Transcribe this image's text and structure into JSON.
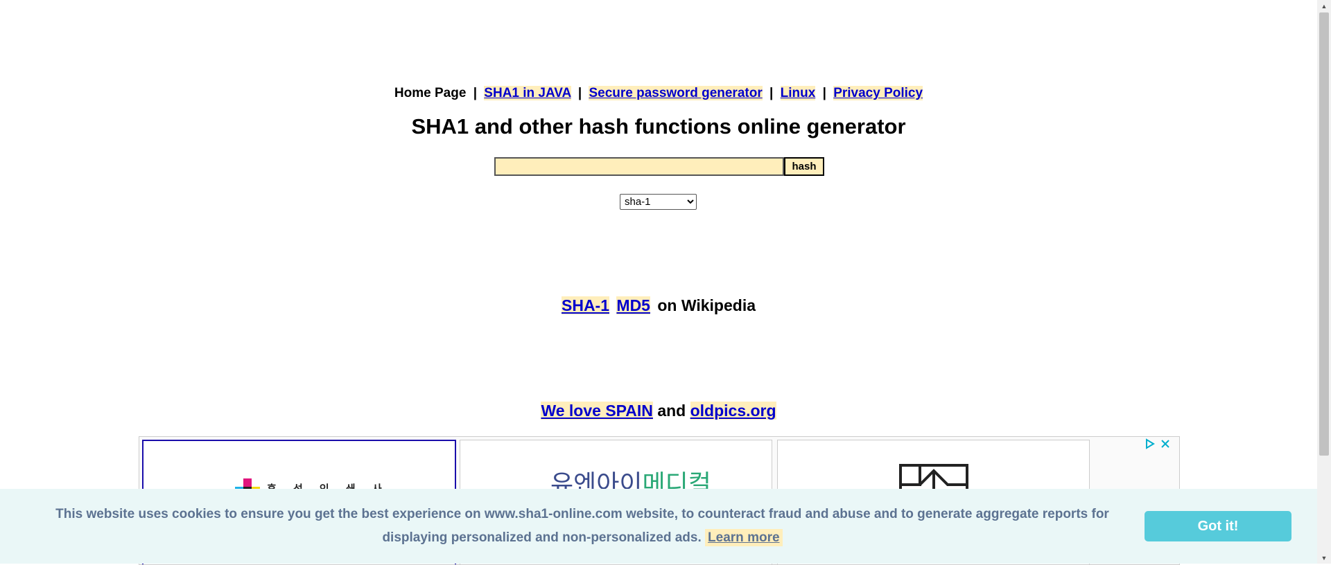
{
  "nav": {
    "home": "Home Page",
    "separator": "|",
    "links": [
      "SHA1 in JAVA",
      "Secure password generator",
      "Linux",
      "Privacy Policy"
    ]
  },
  "main": {
    "title": "SHA1 and other hash functions online generator",
    "input_value": "",
    "hash_button": "hash",
    "algorithm": "sha-1"
  },
  "wiki": {
    "links": [
      "SHA-1",
      "MD5"
    ],
    "suffix": "on Wikipedia"
  },
  "promo": {
    "link1": "We love SPAIN",
    "joiner": "and",
    "link2": "oldpics.org"
  },
  "ads": {
    "card1_text": "후 성 인 쇄 사",
    "card2_part1": "유엔아이",
    "card2_part2": "메디컬"
  },
  "cookie": {
    "message": "This website uses cookies to ensure you get the best experience on www.sha1-online.com website, to counteract fraud and abuse and to generate aggregate reports for displaying personalized and non-personalized ads.",
    "learn_more": "Learn more",
    "button": "Got it!"
  },
  "colors": {
    "link": "#0000cc",
    "highlight": "#ffeebb",
    "cookie_bg": "#eaf7f7",
    "cookie_text": "#5c7291",
    "cookie_button": "#56cbdb"
  },
  "icons": [
    "adchoices-icon",
    "close-icon",
    "chevron-down-icon",
    "scroll-up-arrow-icon",
    "scroll-down-arrow-icon"
  ]
}
